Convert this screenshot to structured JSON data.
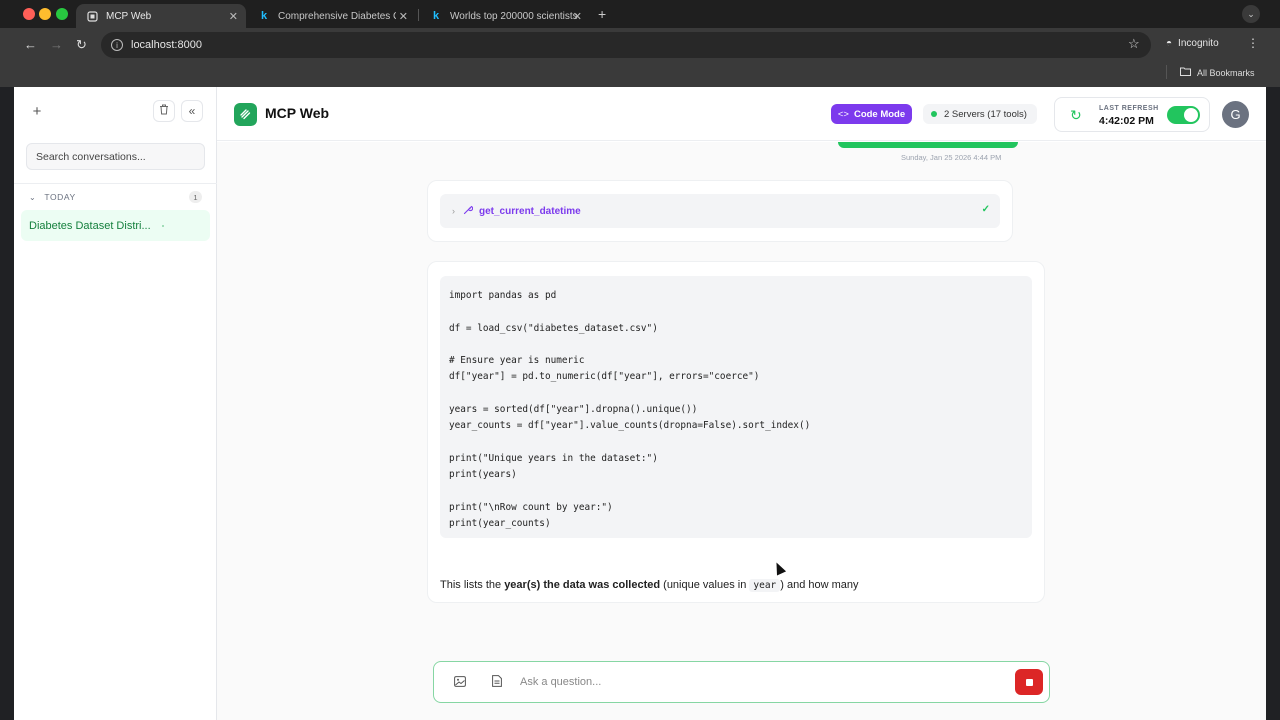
{
  "browser": {
    "tabs": [
      {
        "label": "MCP Web",
        "icon": "mcp-logo-icon"
      },
      {
        "label": "Comprehensive Diabetes Clin",
        "icon": "kaggle-k-icon"
      },
      {
        "label": "Worlds top 200000 scientists",
        "icon": "kaggle-k-icon"
      }
    ],
    "url": "localhost:8000",
    "profile_label": "Incognito",
    "bookmarks_label": "All Bookmarks"
  },
  "sidebar": {
    "search_placeholder": "Search conversations...",
    "section_label": "TODAY",
    "section_count": "1",
    "conversations": [
      {
        "title": "Diabetes Dataset Distri..."
      }
    ]
  },
  "header": {
    "app_title": "MCP Web",
    "code_mode_label": "Code Mode",
    "servers_label": "2 Servers (17 tools)",
    "last_refresh_label": "LAST REFRESH",
    "last_refresh_time": "4:42:02 PM",
    "avatar_initial": "G",
    "accent_color": "#22c55e",
    "code_mode_color": "#7c3aed"
  },
  "chat": {
    "user_message_time": "Sunday, Jan 25 2026 4:44 PM",
    "tool_call_name": "get_current_datetime",
    "code_lines": [
      "import pandas as pd",
      "",
      "df = load_csv(\"diabetes_dataset.csv\")",
      "",
      "# Ensure year is numeric",
      "df[\"year\"] = pd.to_numeric(df[\"year\"], errors=\"coerce\")",
      "",
      "years = sorted(df[\"year\"].dropna().unique())",
      "year_counts = df[\"year\"].value_counts(dropna=False).sort_index()",
      "",
      "print(\"Unique years in the dataset:\")",
      "print(years)",
      "",
      "print(\"\\nRow count by year:\")",
      "print(year_counts)"
    ],
    "answer_prefix": "This lists the ",
    "answer_bold": "year(s) the data was collected",
    "answer_middle": " (unique values in ",
    "answer_code": "year",
    "answer_suffix": ") and how many"
  },
  "composer": {
    "placeholder": "Ask a question..."
  }
}
